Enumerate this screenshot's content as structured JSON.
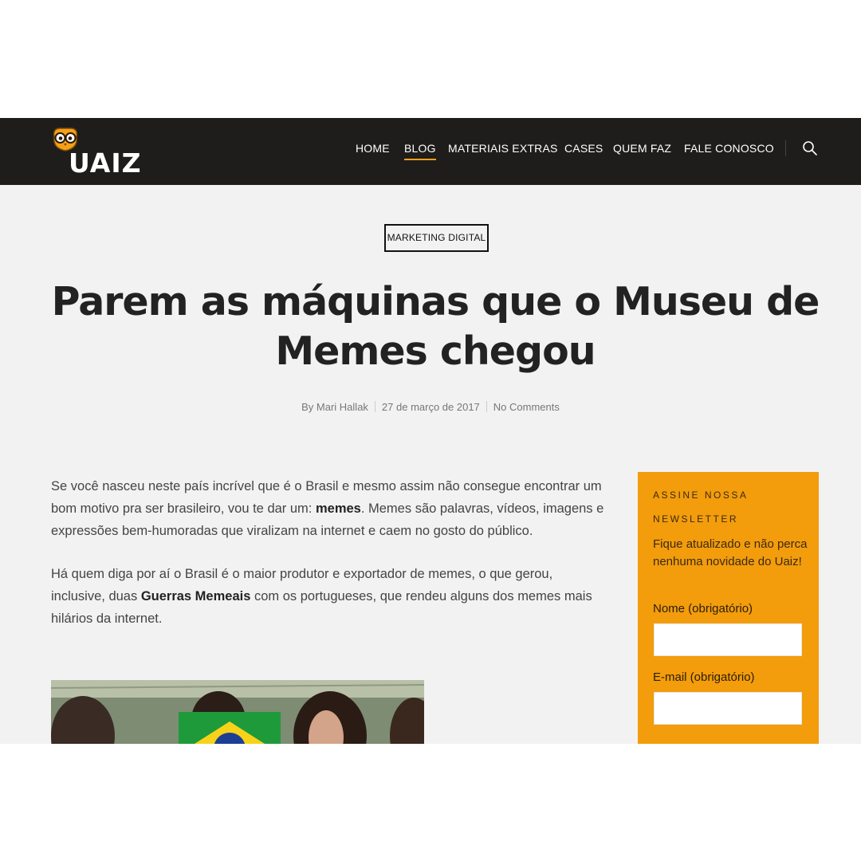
{
  "brand": {
    "logo_text": "UAIZ"
  },
  "nav": {
    "items": [
      {
        "label": "HOME"
      },
      {
        "label": "BLOG"
      },
      {
        "label": "MATERIAIS EXTRAS"
      },
      {
        "label": "CASES"
      },
      {
        "label": "QUEM FAZ"
      },
      {
        "label": "FALE CONOSCO"
      }
    ],
    "active": "BLOG",
    "search_icon": "search-icon"
  },
  "article": {
    "category": "MARKETING DIGITAL",
    "title": "Parem as máquinas que o Museu de Memes chegou",
    "meta": {
      "author": "By Mari Hallak",
      "date": "27 de março de 2017",
      "comments": "No Comments"
    },
    "paragraphs": [
      {
        "before": "Se você nasceu neste país incrível que é o Brasil e mesmo assim não consegue encontrar um bom motivo pra ser brasileiro, vou te dar um: ",
        "link": "memes",
        "after": ". Memes são palavras, vídeos, imagens e expressões bem-humoradas que viralizam na internet e caem no gosto do público."
      },
      {
        "before": "Há quem diga por aí o Brasil é o maior produtor e exportador de memes, o que gerou, inclusive, duas ",
        "link": "Guerras Memeais",
        "after": " com os portugueses, que rendeu alguns dos memes mais hilários da internet."
      }
    ]
  },
  "sidebar": {
    "newsletter": {
      "title": "ASSINE NOSSA NEWSLETTER",
      "description": "Fique atualizado e não perca nenhuma novidade do Uaiz!",
      "name_label": "Nome (obrigatório)",
      "name_value": "",
      "email_label": "E-mail (obrigatório)",
      "email_value": ""
    }
  },
  "colors": {
    "header_bg": "#1f1d1b",
    "accent": "#f39c0c",
    "page_bg": "#f2f2f2"
  }
}
